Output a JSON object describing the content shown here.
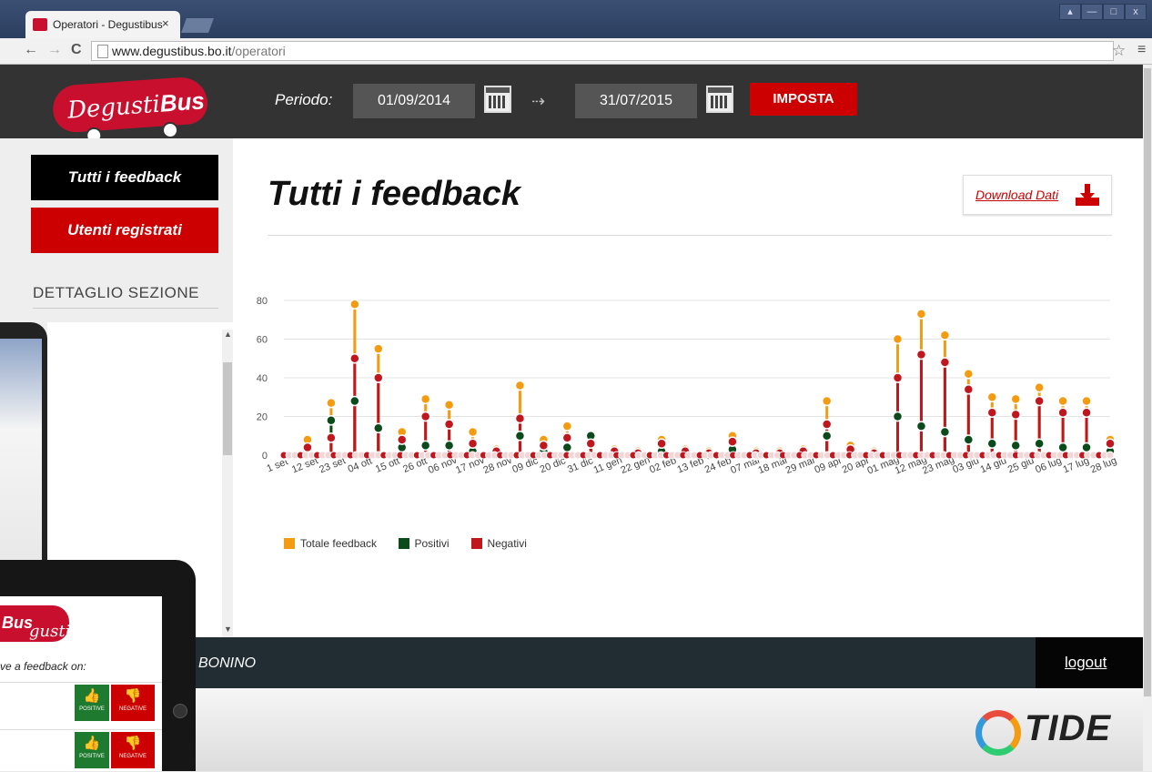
{
  "browser": {
    "tab_title": "Operatori - Degustibus",
    "tab_close": "×",
    "url_domain": "www.degustibus.bo.it",
    "url_path": "/operatori",
    "back": "←",
    "forward": "→",
    "reload": "C",
    "star": "☆",
    "menu": "≡",
    "window_controls": [
      "▴",
      "—",
      "□",
      "x"
    ]
  },
  "header": {
    "logo_pre": "Degusti",
    "logo_bold": "Bus",
    "period_label": "Periodo:",
    "date_from": "01/09/2014",
    "date_to": "31/07/2015",
    "arrow": "⇢",
    "set_button": "IMPOSTA"
  },
  "sidebar": {
    "all_feedback": "Tutti i feedback",
    "registered_users": "Utenti registrati",
    "section_detail": "DETTAGLIO SEZIONE"
  },
  "main": {
    "title": "Tutti i feedback",
    "download_label": "Download Dati"
  },
  "colors": {
    "total": "#f39c12",
    "positive": "#0b4a1a",
    "negative": "#c0161d",
    "brand": "#c8102e"
  },
  "chart_data": {
    "type": "line",
    "ylim": [
      0,
      80
    ],
    "yticks": [
      0,
      20,
      40,
      60,
      80
    ],
    "tick_labels": [
      "1 set",
      "12 set",
      "23 set",
      "04 ott",
      "15 ott",
      "26 ott",
      "06 nov",
      "17 nov",
      "28 nov",
      "09 dic",
      "20 dic",
      "31 dic",
      "11 gen",
      "22 gen",
      "02 feb",
      "13 feb",
      "24 feb",
      "07 mar",
      "18 mar",
      "29 mar",
      "09 apr",
      "20 apr",
      "01 mag",
      "12 mag",
      "23 mag",
      "03 giu",
      "14 giu",
      "25 giu",
      "06 lug",
      "17 lug",
      "28 lug"
    ],
    "series": [
      {
        "name": "Totale feedback",
        "color": "#f39c12",
        "values": [
          0,
          8,
          27,
          78,
          55,
          12,
          29,
          26,
          12,
          3,
          36,
          8,
          15,
          10,
          3,
          2,
          8,
          3,
          2,
          10,
          2,
          2,
          3,
          28,
          5,
          2,
          60,
          73,
          62,
          42,
          30,
          29,
          35,
          28,
          28,
          8
        ]
      },
      {
        "name": "Positivi",
        "color": "#0b4a1a",
        "values": [
          0,
          2,
          18,
          28,
          14,
          4,
          5,
          5,
          2,
          1,
          10,
          2,
          4,
          10,
          1,
          1,
          2,
          1,
          0,
          3,
          0,
          0,
          1,
          10,
          2,
          1,
          20,
          15,
          12,
          8,
          6,
          5,
          6,
          4,
          4,
          2
        ]
      },
      {
        "name": "Negativi",
        "color": "#c0161d",
        "values": [
          0,
          4,
          9,
          50,
          40,
          8,
          20,
          16,
          6,
          2,
          19,
          5,
          9,
          6,
          2,
          1,
          6,
          2,
          1,
          7,
          1,
          1,
          2,
          16,
          3,
          1,
          40,
          52,
          48,
          34,
          22,
          21,
          28,
          22,
          22,
          6
        ]
      }
    ]
  },
  "footer": {
    "user": "BONINO",
    "logout": "logout"
  },
  "brand_footer": {
    "tide": "TIDE"
  },
  "tablet": {
    "logo": "gusti",
    "logo_bold": "Bus",
    "question": "ve a feedback on:",
    "positive": "POSITIVE",
    "negative": "NEGATIVE"
  }
}
